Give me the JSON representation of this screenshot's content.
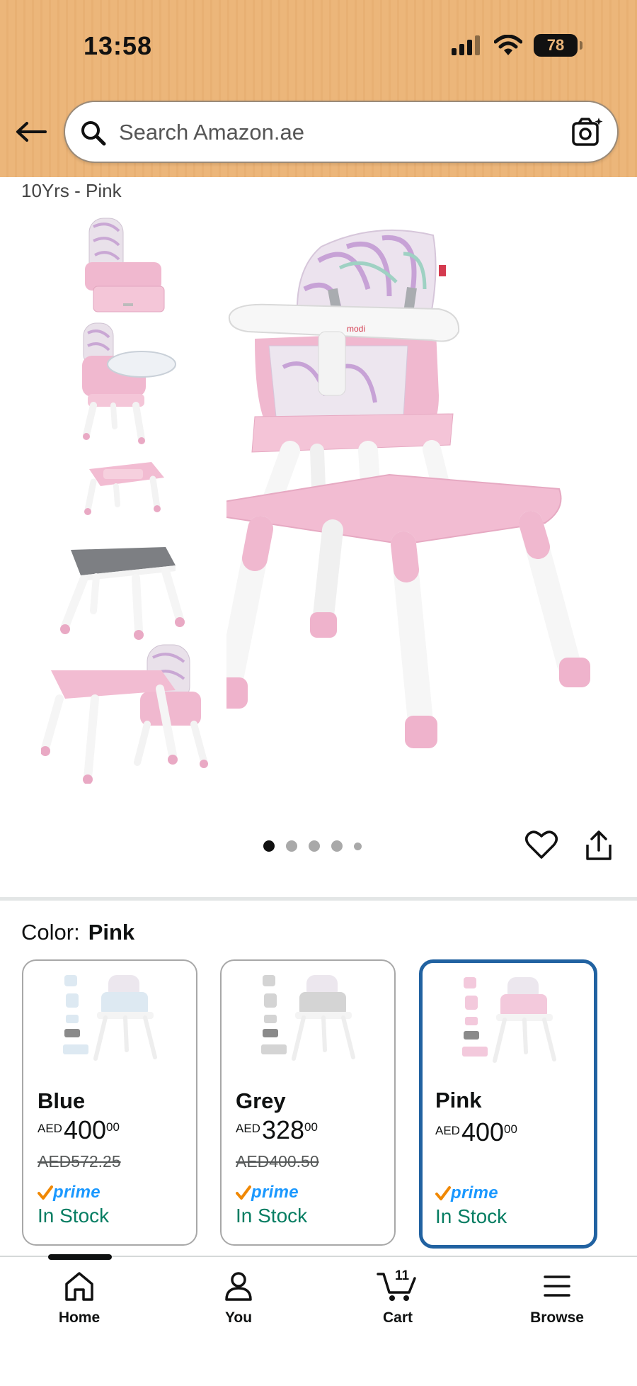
{
  "status_bar": {
    "time": "13:58",
    "battery": "78"
  },
  "search": {
    "placeholder": "Search Amazon.ae"
  },
  "product": {
    "variant_caption": "10Yrs - Pink",
    "image_dots": {
      "count": 5,
      "active_index": 0
    }
  },
  "color_section": {
    "label": "Color:",
    "selected": "Pink"
  },
  "color_options": [
    {
      "name": "Blue",
      "currency": "AED",
      "price_whole": "400",
      "price_fraction": "00",
      "old_price": "AED572.25",
      "prime": "prime",
      "stock": "In Stock",
      "accent": "#dde9f2"
    },
    {
      "name": "Grey",
      "currency": "AED",
      "price_whole": "328",
      "price_fraction": "00",
      "old_price": "AED400.50",
      "prime": "prime",
      "stock": "In Stock",
      "accent": "#d4d4d4"
    },
    {
      "name": "Pink",
      "currency": "AED",
      "price_whole": "400",
      "price_fraction": "00",
      "old_price": "",
      "prime": "prime",
      "stock": "In Stock",
      "accent": "#f3c9dc"
    }
  ],
  "bottom_nav": {
    "home": "Home",
    "you": "You",
    "cart": "Cart",
    "cart_count": "11",
    "browse": "Browse"
  },
  "colors": {
    "header_bg": "#ecb67a",
    "selected_border": "#2162a1",
    "in_stock": "#067d62",
    "prime_blue": "#1a98ff",
    "product_pink": "#f0b8cf"
  }
}
